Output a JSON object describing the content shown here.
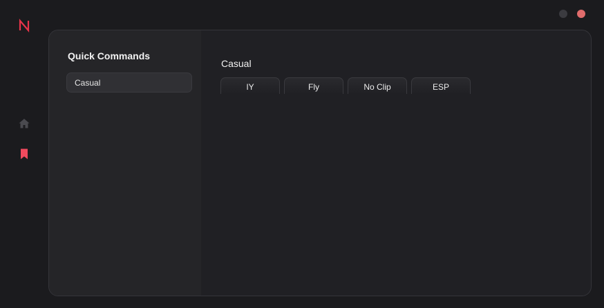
{
  "app": {
    "logo_letter": "N",
    "accent": "#e8344a"
  },
  "nav": {
    "items": [
      {
        "icon": "home-icon",
        "active": false
      },
      {
        "icon": "bookmark-icon",
        "active": true
      }
    ]
  },
  "window_controls": {
    "minimize_color": "#3b3b40",
    "close_color": "#e06c6c"
  },
  "sidebar": {
    "title": "Quick Commands",
    "items": [
      {
        "label": "Casual"
      }
    ]
  },
  "content": {
    "title": "Casual",
    "commands": [
      {
        "label": "IY"
      },
      {
        "label": "Fly"
      },
      {
        "label": "No Clip"
      },
      {
        "label": "ESP"
      }
    ]
  }
}
